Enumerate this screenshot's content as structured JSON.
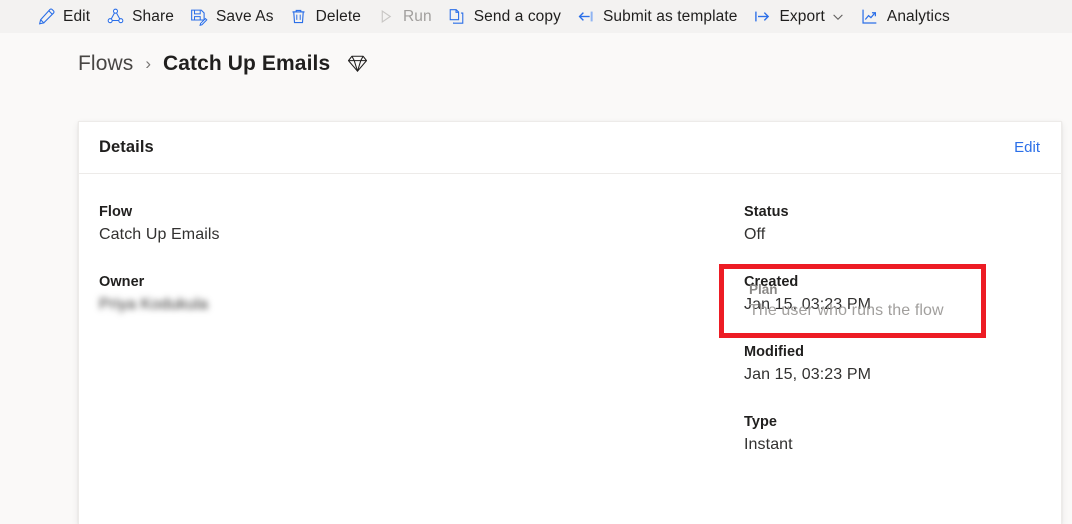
{
  "colors": {
    "accent_blue": "#2b6fe8",
    "icon_blue": "#2b6fe8",
    "highlight_red": "#ed1c24",
    "page_bg": "#faf9f8",
    "toolbar_bg": "#f3f2f1",
    "card_bg": "#ffffff",
    "disabled_gray": "#a19f9d"
  },
  "commandbar": {
    "items": [
      {
        "label": "Edit",
        "icon": "pencil-icon",
        "disabled": false
      },
      {
        "label": "Share",
        "icon": "share-icon",
        "disabled": false
      },
      {
        "label": "Save As",
        "icon": "save-as-icon",
        "disabled": false
      },
      {
        "label": "Delete",
        "icon": "trash-icon",
        "disabled": false
      },
      {
        "label": "Run",
        "icon": "play-icon",
        "disabled": true
      },
      {
        "label": "Send a copy",
        "icon": "copy-icon",
        "disabled": false
      },
      {
        "label": "Submit as template",
        "icon": "arrow-to-bar-left-icon",
        "disabled": false
      },
      {
        "label": "Export",
        "icon": "arrow-from-bar-right-icon",
        "disabled": false,
        "chevron": "chevron-down-icon"
      },
      {
        "label": "Analytics",
        "icon": "line-chart-icon",
        "disabled": false
      }
    ]
  },
  "breadcrumb": {
    "parent": "Flows",
    "separator": "›",
    "current": "Catch Up Emails",
    "badge_icon": "gem-diamond-icon"
  },
  "details_card": {
    "title": "Details",
    "edit_link": "Edit",
    "left_fields": [
      {
        "key": "Flow",
        "value": "Catch Up Emails",
        "blurred": false
      },
      {
        "key": "Owner",
        "value": "Priya Kodukula",
        "blurred": true
      }
    ],
    "right_fields": [
      {
        "key": "Status",
        "value": "Off"
      },
      {
        "key": "Created",
        "value": "Jan 15, 03:23 PM"
      },
      {
        "key": "Modified",
        "value": "Jan 15, 03:23 PM"
      },
      {
        "key": "Type",
        "value": "Instant"
      }
    ],
    "plan": {
      "key": "Plan",
      "value": "The user who runs the flow"
    }
  }
}
